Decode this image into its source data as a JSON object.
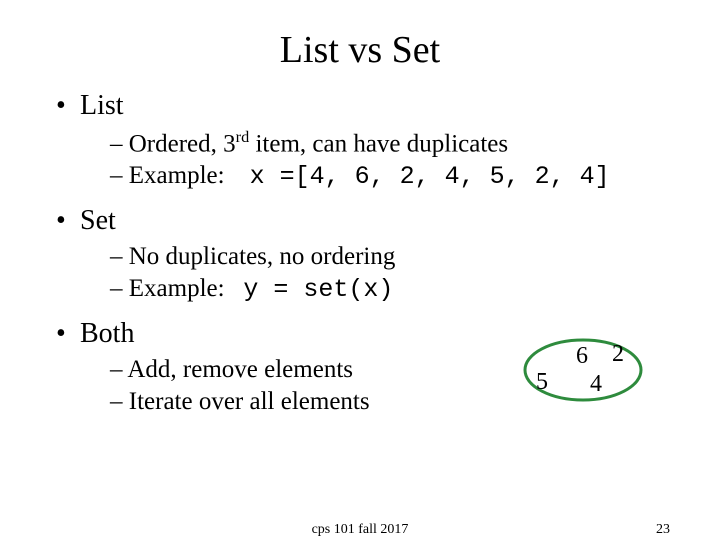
{
  "title": "List vs Set",
  "sections": {
    "list": {
      "heading": "List",
      "sub1_prefix": "Ordered, 3",
      "sub1_sup": "rd",
      "sub1_suffix": " item, can have duplicates",
      "sub2_label": "Example:    ",
      "sub2_code": "x =[4, 6, 2, 4, 5, 2, 4]"
    },
    "set": {
      "heading": "Set",
      "sub1": "No duplicates, no ordering",
      "sub2_label": "Example:   ",
      "sub2_code": "y = set(x)"
    },
    "both": {
      "heading": "Both",
      "sub1": "Add, remove elements",
      "sub2": "Iterate over all elements"
    }
  },
  "set_diagram": {
    "values": {
      "a": "6",
      "b": "2",
      "c": "5",
      "d": "4"
    },
    "stroke": "#2e8b3d"
  },
  "footer": {
    "center": "cps 101 fall 2017",
    "page": "23"
  }
}
